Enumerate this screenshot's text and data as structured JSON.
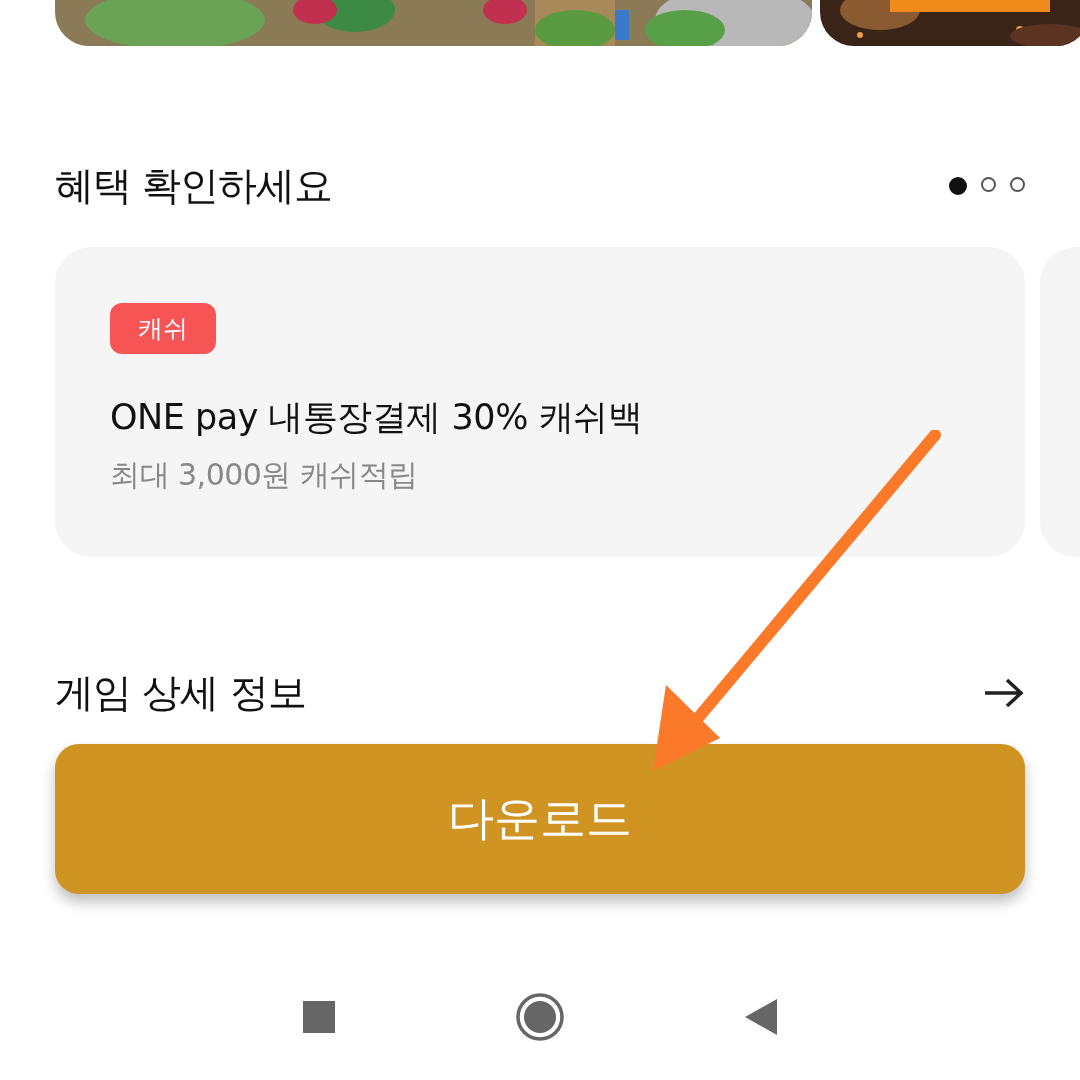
{
  "benefits": {
    "title": "혜택 확인하세요",
    "pages": [
      {
        "selected": true
      },
      {
        "selected": false
      },
      {
        "selected": false
      }
    ],
    "cards": [
      {
        "tag": "캐쉬",
        "color": "#f75555",
        "title": "ONE pay 내통장결제 30% 캐쉬백",
        "subtitle": "최대 3,000원 캐쉬적립"
      }
    ]
  },
  "details": {
    "title": "게임 상세 정보"
  },
  "download_button": {
    "label": "다운로드"
  }
}
